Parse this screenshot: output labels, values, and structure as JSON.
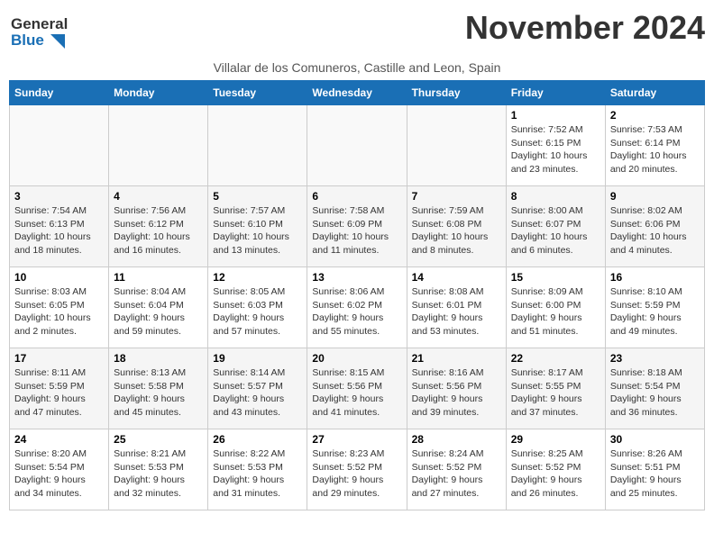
{
  "header": {
    "logo_line1": "General",
    "logo_line2": "Blue",
    "month_title": "November 2024",
    "subtitle": "Villalar de los Comuneros, Castille and Leon, Spain"
  },
  "weekdays": [
    "Sunday",
    "Monday",
    "Tuesday",
    "Wednesday",
    "Thursday",
    "Friday",
    "Saturday"
  ],
  "weeks": [
    [
      {
        "day": "",
        "info": ""
      },
      {
        "day": "",
        "info": ""
      },
      {
        "day": "",
        "info": ""
      },
      {
        "day": "",
        "info": ""
      },
      {
        "day": "",
        "info": ""
      },
      {
        "day": "1",
        "info": "Sunrise: 7:52 AM\nSunset: 6:15 PM\nDaylight: 10 hours and 23 minutes."
      },
      {
        "day": "2",
        "info": "Sunrise: 7:53 AM\nSunset: 6:14 PM\nDaylight: 10 hours and 20 minutes."
      }
    ],
    [
      {
        "day": "3",
        "info": "Sunrise: 7:54 AM\nSunset: 6:13 PM\nDaylight: 10 hours and 18 minutes."
      },
      {
        "day": "4",
        "info": "Sunrise: 7:56 AM\nSunset: 6:12 PM\nDaylight: 10 hours and 16 minutes."
      },
      {
        "day": "5",
        "info": "Sunrise: 7:57 AM\nSunset: 6:10 PM\nDaylight: 10 hours and 13 minutes."
      },
      {
        "day": "6",
        "info": "Sunrise: 7:58 AM\nSunset: 6:09 PM\nDaylight: 10 hours and 11 minutes."
      },
      {
        "day": "7",
        "info": "Sunrise: 7:59 AM\nSunset: 6:08 PM\nDaylight: 10 hours and 8 minutes."
      },
      {
        "day": "8",
        "info": "Sunrise: 8:00 AM\nSunset: 6:07 PM\nDaylight: 10 hours and 6 minutes."
      },
      {
        "day": "9",
        "info": "Sunrise: 8:02 AM\nSunset: 6:06 PM\nDaylight: 10 hours and 4 minutes."
      }
    ],
    [
      {
        "day": "10",
        "info": "Sunrise: 8:03 AM\nSunset: 6:05 PM\nDaylight: 10 hours and 2 minutes."
      },
      {
        "day": "11",
        "info": "Sunrise: 8:04 AM\nSunset: 6:04 PM\nDaylight: 9 hours and 59 minutes."
      },
      {
        "day": "12",
        "info": "Sunrise: 8:05 AM\nSunset: 6:03 PM\nDaylight: 9 hours and 57 minutes."
      },
      {
        "day": "13",
        "info": "Sunrise: 8:06 AM\nSunset: 6:02 PM\nDaylight: 9 hours and 55 minutes."
      },
      {
        "day": "14",
        "info": "Sunrise: 8:08 AM\nSunset: 6:01 PM\nDaylight: 9 hours and 53 minutes."
      },
      {
        "day": "15",
        "info": "Sunrise: 8:09 AM\nSunset: 6:00 PM\nDaylight: 9 hours and 51 minutes."
      },
      {
        "day": "16",
        "info": "Sunrise: 8:10 AM\nSunset: 5:59 PM\nDaylight: 9 hours and 49 minutes."
      }
    ],
    [
      {
        "day": "17",
        "info": "Sunrise: 8:11 AM\nSunset: 5:59 PM\nDaylight: 9 hours and 47 minutes."
      },
      {
        "day": "18",
        "info": "Sunrise: 8:13 AM\nSunset: 5:58 PM\nDaylight: 9 hours and 45 minutes."
      },
      {
        "day": "19",
        "info": "Sunrise: 8:14 AM\nSunset: 5:57 PM\nDaylight: 9 hours and 43 minutes."
      },
      {
        "day": "20",
        "info": "Sunrise: 8:15 AM\nSunset: 5:56 PM\nDaylight: 9 hours and 41 minutes."
      },
      {
        "day": "21",
        "info": "Sunrise: 8:16 AM\nSunset: 5:56 PM\nDaylight: 9 hours and 39 minutes."
      },
      {
        "day": "22",
        "info": "Sunrise: 8:17 AM\nSunset: 5:55 PM\nDaylight: 9 hours and 37 minutes."
      },
      {
        "day": "23",
        "info": "Sunrise: 8:18 AM\nSunset: 5:54 PM\nDaylight: 9 hours and 36 minutes."
      }
    ],
    [
      {
        "day": "24",
        "info": "Sunrise: 8:20 AM\nSunset: 5:54 PM\nDaylight: 9 hours and 34 minutes."
      },
      {
        "day": "25",
        "info": "Sunrise: 8:21 AM\nSunset: 5:53 PM\nDaylight: 9 hours and 32 minutes."
      },
      {
        "day": "26",
        "info": "Sunrise: 8:22 AM\nSunset: 5:53 PM\nDaylight: 9 hours and 31 minutes."
      },
      {
        "day": "27",
        "info": "Sunrise: 8:23 AM\nSunset: 5:52 PM\nDaylight: 9 hours and 29 minutes."
      },
      {
        "day": "28",
        "info": "Sunrise: 8:24 AM\nSunset: 5:52 PM\nDaylight: 9 hours and 27 minutes."
      },
      {
        "day": "29",
        "info": "Sunrise: 8:25 AM\nSunset: 5:52 PM\nDaylight: 9 hours and 26 minutes."
      },
      {
        "day": "30",
        "info": "Sunrise: 8:26 AM\nSunset: 5:51 PM\nDaylight: 9 hours and 25 minutes."
      }
    ]
  ]
}
